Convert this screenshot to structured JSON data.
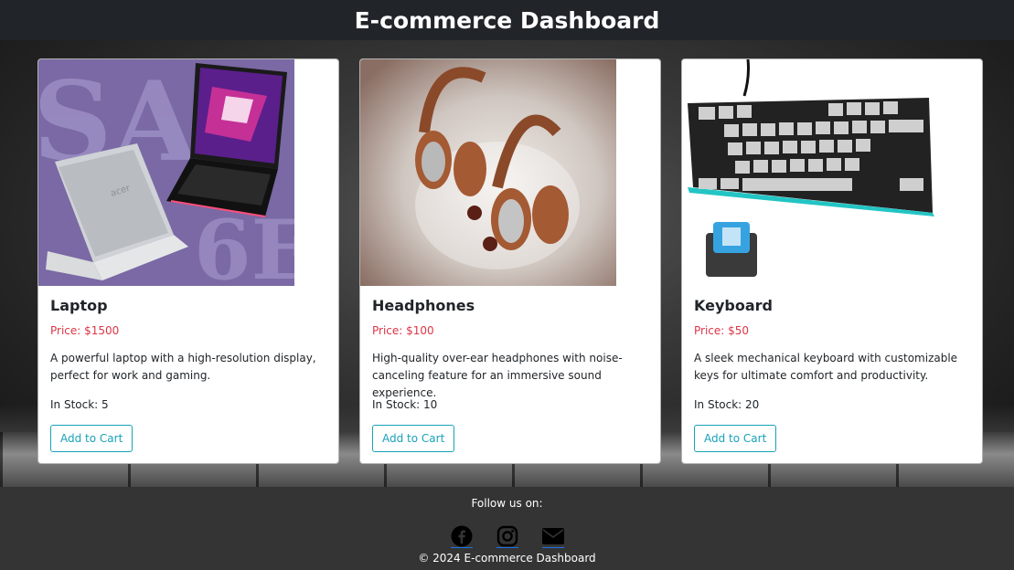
{
  "header": {
    "title": "E-commerce Dashboard"
  },
  "products": [
    {
      "name": "Laptop",
      "price": "Price: $1500",
      "description": "A powerful laptop with a high-resolution display, perfect for work and gaming.",
      "stock": "In Stock: 5",
      "button": "Add to Cart",
      "image_icon": "laptop-image"
    },
    {
      "name": "Headphones",
      "price": "Price: $100",
      "description": "High-quality over-ear headphones with noise-canceling feature for an immersive sound experience.",
      "stock": "In Stock: 10",
      "button": "Add to Cart",
      "image_icon": "headphones-image"
    },
    {
      "name": "Keyboard",
      "price": "Price: $50",
      "description": "A sleek mechanical keyboard with customizable keys for ultimate comfort and productivity.",
      "stock": "In Stock: 20",
      "button": "Add to Cart",
      "image_icon": "keyboard-image"
    }
  ],
  "footer": {
    "follow_label": "Follow us on:",
    "social_icons": [
      "facebook-icon",
      "instagram-icon",
      "envelope-icon"
    ],
    "copyright": "© 2024 E-commerce Dashboard"
  },
  "colors": {
    "navbar": "#212529",
    "price": "#dc3545",
    "button": "#17a2b8",
    "footer": "#343434"
  }
}
